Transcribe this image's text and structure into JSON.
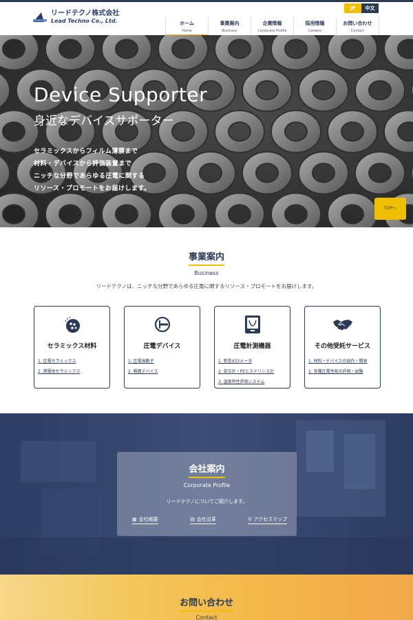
{
  "header": {
    "logo_jp": "リードテクノ株式会社",
    "logo_en": "Lead Techno Co., Ltd.",
    "lang": [
      "JP",
      "中文"
    ],
    "nav": [
      {
        "jp": "ホーム",
        "en": "Home",
        "active": true
      },
      {
        "jp": "事業案内",
        "en": "Business"
      },
      {
        "jp": "企業情報",
        "en": "Corporate Profile"
      },
      {
        "jp": "採用情報",
        "en": "Careers"
      },
      {
        "jp": "お問い合わせ",
        "en": "Contact"
      }
    ]
  },
  "hero": {
    "title": "Device Supporter",
    "subtitle": "身近なデバイスサポーター",
    "copy": [
      "セラミックスからフィルム薄膜まで",
      "材料・デバイスから評価装置まで",
      "ニッチな分野であらゆる圧電に関する",
      "リソース・プロモートをお届けします。"
    ],
    "top_button": "TOPへ"
  },
  "business": {
    "title_jp": "事業案内",
    "title_en": "Business",
    "lead": "リードテクノは、ニッチな分野であらゆる圧電に関するリソース・プロモートをお届けします。",
    "cards": [
      {
        "title": "セラミックス材料",
        "icon": "ceramics-icon",
        "items": [
          "1. 圧電セラミックス",
          "2. 誘電体セラミックス"
        ]
      },
      {
        "title": "圧電デバイス",
        "icon": "device-icon",
        "items": [
          "1. 圧電振動子",
          "2. 積層デバイス"
        ]
      },
      {
        "title": "圧電計測機器",
        "icon": "measurement-icon",
        "items": [
          "1. 新型d33メータ",
          "2. 変位計・PEヒステリシス計",
          "3. 温度特性評価システム"
        ]
      },
      {
        "title": "その他受託サービス",
        "icon": "handshake-icon",
        "items": [
          "1. 材料・デバイスの試作・開発",
          "2. 各種圧電性能の評価・試験"
        ]
      }
    ]
  },
  "company": {
    "title_jp": "会社案内",
    "title_en": "Corporate Profile",
    "lead": "リードテクノについてご紹介します。",
    "links": [
      {
        "label": "会社概要",
        "icon": "building-icon"
      },
      {
        "label": "会社沿革",
        "icon": "document-icon"
      },
      {
        "label": "アクセスマップ",
        "icon": "map-pin-icon"
      }
    ]
  },
  "contact": {
    "title_jp": "お問い合わせ",
    "title_en": "Contact"
  },
  "colors": {
    "navy": "#2b3a55",
    "accent": "#f0c000"
  }
}
